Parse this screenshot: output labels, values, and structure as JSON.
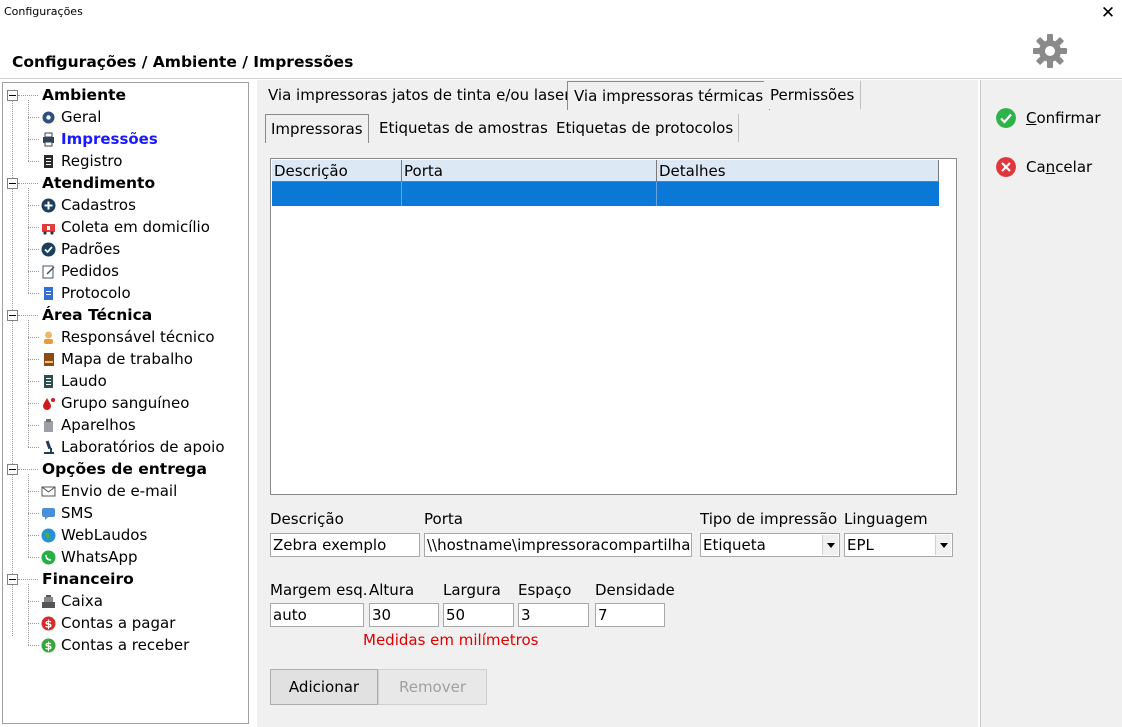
{
  "window": {
    "title": "Configurações",
    "close_glyph": "✕"
  },
  "breadcrumb": "Configurações / Ambiente / Impressões",
  "tree": {
    "categories": [
      {
        "label": "Ambiente",
        "items": [
          {
            "label": "Geral",
            "icon": "gear-icon"
          },
          {
            "label": "Impressões",
            "icon": "printer-icon",
            "selected": true
          },
          {
            "label": "Registro",
            "icon": "document-icon"
          }
        ]
      },
      {
        "label": "Atendimento",
        "items": [
          {
            "label": "Cadastros",
            "icon": "plus-circle-icon"
          },
          {
            "label": "Coleta em domicílio",
            "icon": "ambulance-icon"
          },
          {
            "label": "Padrões",
            "icon": "check-circle-icon"
          },
          {
            "label": "Pedidos",
            "icon": "notepad-icon"
          },
          {
            "label": "Protocolo",
            "icon": "blue-document-icon"
          }
        ]
      },
      {
        "label": "Área Técnica",
        "items": [
          {
            "label": "Responsável técnico",
            "icon": "person-icon"
          },
          {
            "label": "Mapa de trabalho",
            "icon": "book-icon"
          },
          {
            "label": "Laudo",
            "icon": "report-icon"
          },
          {
            "label": "Grupo sanguíneo",
            "icon": "blood-drop-icon"
          },
          {
            "label": "Aparelhos",
            "icon": "device-icon"
          },
          {
            "label": "Laboratórios de apoio",
            "icon": "microscope-icon"
          }
        ]
      },
      {
        "label": "Opções de entrega",
        "items": [
          {
            "label": "Envio de e-mail",
            "icon": "envelope-icon"
          },
          {
            "label": "SMS",
            "icon": "sms-icon"
          },
          {
            "label": "WebLaudos",
            "icon": "globe-icon"
          },
          {
            "label": "WhatsApp",
            "icon": "whatsapp-icon"
          }
        ]
      },
      {
        "label": "Financeiro",
        "items": [
          {
            "label": "Caixa",
            "icon": "cash-register-icon"
          },
          {
            "label": "Contas a pagar",
            "icon": "dollar-red-icon"
          },
          {
            "label": "Contas a receber",
            "icon": "dollar-green-icon"
          }
        ]
      }
    ]
  },
  "tabs": {
    "main": [
      "Via impressoras jatos de tinta e/ou laser",
      "Via impressoras térmicas",
      "Permissões"
    ],
    "sub": [
      "Impressoras",
      "Etiquetas de amostras",
      "Etiquetas de protocolos"
    ]
  },
  "grid": {
    "columns": [
      "Descrição",
      "Porta",
      "Detalhes"
    ]
  },
  "form": {
    "descricao": {
      "label": "Descrição",
      "value": "Zebra exemplo"
    },
    "porta": {
      "label": "Porta",
      "value": "\\\\hostname\\impressoracompartilhada"
    },
    "tipo": {
      "label": "Tipo de impressão",
      "value": "Etiqueta"
    },
    "linguagem": {
      "label": "Linguagem",
      "value": "EPL"
    },
    "margem": {
      "label": "Margem esq.",
      "value": "auto"
    },
    "altura": {
      "label": "Altura",
      "value": "30"
    },
    "largura": {
      "label": "Largura",
      "value": "50"
    },
    "espaco": {
      "label": "Espaço",
      "value": "3"
    },
    "densidade": {
      "label": "Densidade",
      "value": "7"
    },
    "note": "Medidas em milímetros",
    "add_label": "Adicionar",
    "remove_label": "Remover"
  },
  "actions": {
    "confirm": "Confirmar",
    "cancel": "Cancelar"
  },
  "colors": {
    "selection": "#0a78d7",
    "note": "#e00000",
    "selected_text": "#1a1aff",
    "confirm": "#2db34a",
    "cancel": "#e0363c"
  }
}
